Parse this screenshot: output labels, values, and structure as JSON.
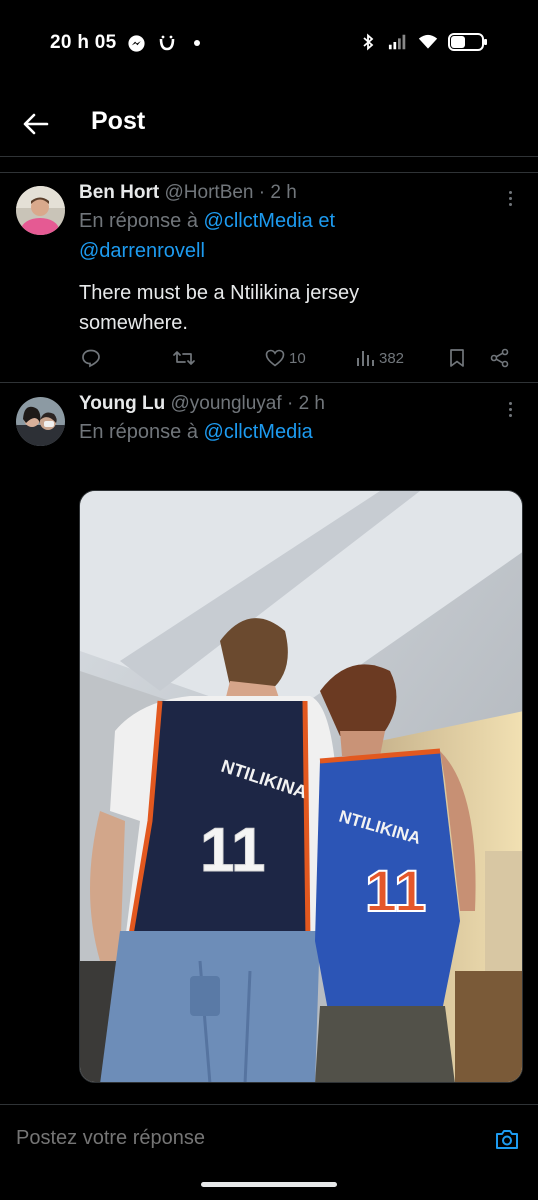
{
  "status_bar": {
    "time": "20 h 05"
  },
  "header": {
    "title": "Post"
  },
  "tweets": [
    {
      "author": "Ben Hort",
      "handle": "@HortBen",
      "separator": "·",
      "time": "2 h",
      "reply_prefix": "En réponse à",
      "mentions": [
        "@cllctMedia",
        "@darrenrovell"
      ],
      "reply_joiner": "et",
      "text": "There must be a Ntilikina jersey somewhere.",
      "likes": "10",
      "views": "382"
    },
    {
      "author": "Young Lu",
      "handle": "@youngluyaf",
      "separator": "·",
      "time": "2 h",
      "reply_prefix": "En réponse à",
      "mentions": [
        "@cllctMedia"
      ],
      "jersey_name": "NTILIKINA",
      "jersey_number": "11"
    }
  ],
  "composer": {
    "placeholder": "Postez votre réponse"
  },
  "colors": {
    "background": "#000000",
    "text": "#e7e9ea",
    "muted": "#71767b",
    "accent": "#1d9bf0",
    "divider": "#2f3336"
  }
}
